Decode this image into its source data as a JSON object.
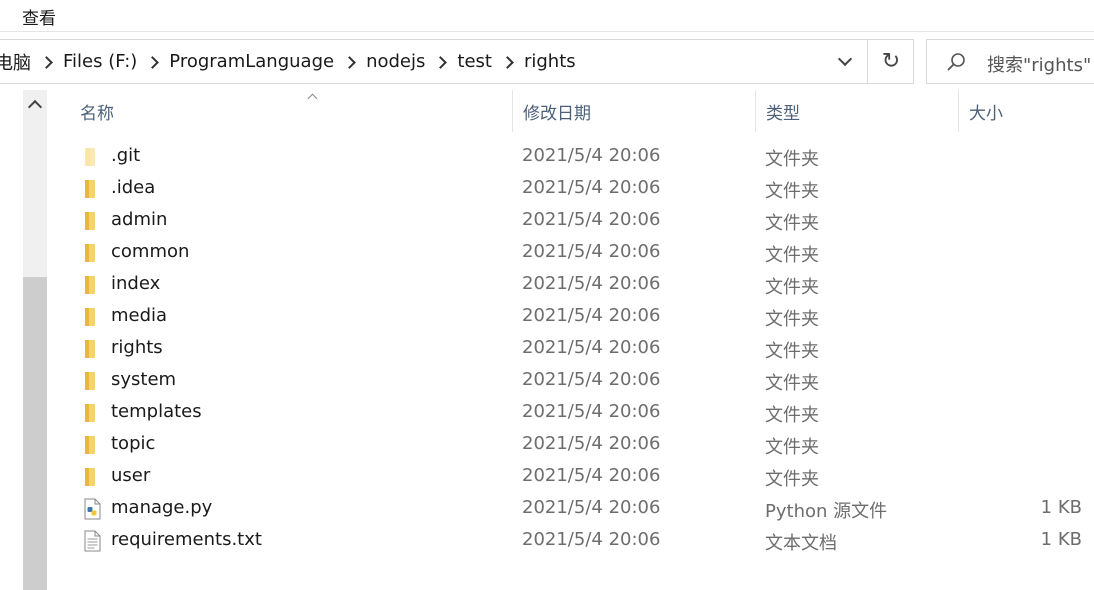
{
  "menubar": {
    "view_label": "查看"
  },
  "address": {
    "crumbs": [
      "电脑",
      "Files (F:)",
      "ProgramLanguage",
      "nodejs",
      "test",
      "rights"
    ],
    "dropdown_icon": "chevron-down-icon",
    "refresh_icon": "↻"
  },
  "search": {
    "placeholder": "搜索\"rights\""
  },
  "columns": {
    "name": "名称",
    "date": "修改日期",
    "type": "类型",
    "size": "大小"
  },
  "files": [
    {
      "name": ".git",
      "date": "2021/5/4 20:06",
      "type": "文件夹",
      "size": "",
      "icon": "folder-icon-faded"
    },
    {
      "name": ".idea",
      "date": "2021/5/4 20:06",
      "type": "文件夹",
      "size": "",
      "icon": "folder-icon"
    },
    {
      "name": "admin",
      "date": "2021/5/4 20:06",
      "type": "文件夹",
      "size": "",
      "icon": "folder-icon"
    },
    {
      "name": "common",
      "date": "2021/5/4 20:06",
      "type": "文件夹",
      "size": "",
      "icon": "folder-icon"
    },
    {
      "name": "index",
      "date": "2021/5/4 20:06",
      "type": "文件夹",
      "size": "",
      "icon": "folder-icon"
    },
    {
      "name": "media",
      "date": "2021/5/4 20:06",
      "type": "文件夹",
      "size": "",
      "icon": "folder-icon"
    },
    {
      "name": "rights",
      "date": "2021/5/4 20:06",
      "type": "文件夹",
      "size": "",
      "icon": "folder-icon"
    },
    {
      "name": "system",
      "date": "2021/5/4 20:06",
      "type": "文件夹",
      "size": "",
      "icon": "folder-icon"
    },
    {
      "name": "templates",
      "date": "2021/5/4 20:06",
      "type": "文件夹",
      "size": "",
      "icon": "folder-icon"
    },
    {
      "name": "topic",
      "date": "2021/5/4 20:06",
      "type": "文件夹",
      "size": "",
      "icon": "folder-icon"
    },
    {
      "name": "user",
      "date": "2021/5/4 20:06",
      "type": "文件夹",
      "size": "",
      "icon": "folder-icon"
    },
    {
      "name": "manage.py",
      "date": "2021/5/4 20:06",
      "type": "Python 源文件",
      "size": "1 KB",
      "icon": "python-file-icon"
    },
    {
      "name": "requirements.txt",
      "date": "2021/5/4 20:06",
      "type": "文本文档",
      "size": "1 KB",
      "icon": "text-file-icon"
    }
  ],
  "colors": {
    "folder": "#f6d26b",
    "folder_dark": "#e8b83a",
    "header_text": "#4c607a",
    "muted_text": "#6d6d6d"
  }
}
